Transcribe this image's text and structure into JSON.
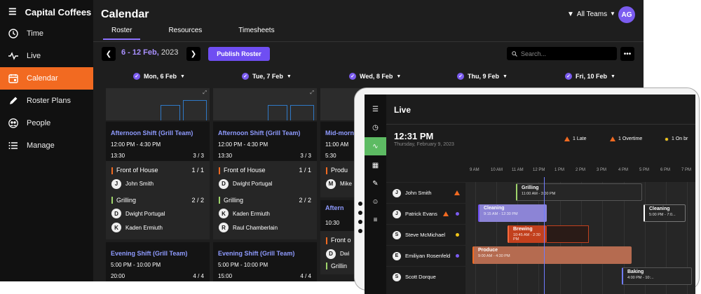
{
  "app": {
    "name": "Capital Coffees"
  },
  "nav": [
    {
      "label": "Time",
      "icon": "clock-icon"
    },
    {
      "label": "Live",
      "icon": "pulse-icon"
    },
    {
      "label": "Calendar",
      "icon": "calendar-icon",
      "active": true
    },
    {
      "label": "Roster Plans",
      "icon": "pencil-icon"
    },
    {
      "label": "People",
      "icon": "people-icon"
    },
    {
      "label": "Manage",
      "icon": "list-icon"
    }
  ],
  "page": {
    "title": "Calendar",
    "teams_label": "All Teams",
    "avatar_initials": "AG"
  },
  "tabs": [
    "Roster",
    "Resources",
    "Timesheets"
  ],
  "toolbar": {
    "date_range": "6 - 12 Feb,",
    "year": "2023",
    "publish_label": "Publish Roster",
    "search_placeholder": "Search..."
  },
  "days": [
    "Mon, 6 Feb",
    "Tue, 7 Feb",
    "Wed, 8 Feb",
    "Thu, 9 Feb",
    "Fri, 10 Feb"
  ],
  "columns": [
    {
      "shift1": {
        "name": "Afternoon Shift (Grill Team)",
        "time": "12:00 PM - 4:30 PM",
        "hours": "13:30",
        "count": "3 / 3"
      },
      "role1": {
        "name": "Front of House",
        "count": "1 / 1",
        "color": "#f26a21",
        "people": [
          {
            "i": "J",
            "n": "John Smith"
          }
        ]
      },
      "role2": {
        "name": "Grilling",
        "count": "2 / 2",
        "color": "#9fd46b",
        "people": [
          {
            "i": "D",
            "n": "Dwight Portugal"
          },
          {
            "i": "K",
            "n": "Kaden Ermiuth"
          }
        ]
      },
      "shift2": {
        "name": "Evening Shift (Grill Team)",
        "time": "5:00 PM - 10:00 PM",
        "hours": "20:00",
        "count": "4 / 4"
      }
    },
    {
      "shift1": {
        "name": "Afternoon Shift (Grill Team)",
        "time": "12:00 PM - 4:30 PM",
        "hours": "13:30",
        "count": "3 / 3"
      },
      "role1": {
        "name": "Front of House",
        "count": "1 / 1",
        "color": "#f26a21",
        "people": [
          {
            "i": "D",
            "n": "Dwight Portugal"
          }
        ]
      },
      "role2": {
        "name": "Grilling",
        "count": "2 / 2",
        "color": "#9fd46b",
        "people": [
          {
            "i": "K",
            "n": "Kaden Ermiuth"
          },
          {
            "i": "R",
            "n": "Raul Chamberlain"
          }
        ]
      },
      "shift2": {
        "name": "Evening Shift (Grill Team)",
        "time": "5:00 PM - 10:00 PM",
        "hours": "15:00",
        "count": "4 / 4"
      }
    },
    {
      "shift1": {
        "name": "Mid-morn",
        "time": "11:00 AM",
        "hours": "5:30"
      },
      "role1": {
        "name": "Produ",
        "color": "#f26a21",
        "people": [
          {
            "i": "M",
            "n": "Mike"
          }
        ]
      },
      "shift2": {
        "name": "Aftern",
        "hours": "10:30"
      },
      "role2": {
        "name": "Front o",
        "person_initial": "D",
        "person": "Dwi"
      },
      "role3": "Grillin"
    }
  ],
  "live": {
    "title": "Live",
    "time": "12:31 PM",
    "date": "Thursday, February 9, 2023",
    "stats": [
      {
        "label": "1 Late"
      },
      {
        "label": "1 Overtime"
      },
      {
        "label": "1 On br"
      }
    ],
    "hours": [
      "9 AM",
      "10 AM",
      "11 AM",
      "12 PM",
      "1 PM",
      "2 PM",
      "3 PM",
      "4 PM",
      "5 PM",
      "6 PM",
      "7 PM"
    ],
    "employees": [
      {
        "i": "J",
        "n": "John Smith",
        "flag": "late"
      },
      {
        "i": "J",
        "n": "Patrick Evans",
        "flag": "overtime",
        "dot": "#7b5cf0"
      },
      {
        "i": "S",
        "n": "Steve McMichael",
        "dot": "#f0c419"
      },
      {
        "i": "E",
        "n": "Emiliyan Rosenfeld",
        "dot": "#7b5cf0"
      },
      {
        "i": "S",
        "n": "Scott Dorque"
      }
    ],
    "shifts": [
      {
        "name": "Grilling",
        "time": "11:00 AM - 3:00 PM"
      },
      {
        "name": "Cleaning",
        "time": "9:15 AM - 12:30 PM"
      },
      {
        "name": "Cleaning",
        "time": "5:00 PM - 7:0..."
      },
      {
        "name": "Brewing",
        "time": "10:45 AM - 2:30 PM"
      },
      {
        "name": "Produce",
        "time": "9:00 AM - 4:30 PM"
      },
      {
        "name": "Baking",
        "time": "4:00 PM - 10:..."
      }
    ]
  }
}
